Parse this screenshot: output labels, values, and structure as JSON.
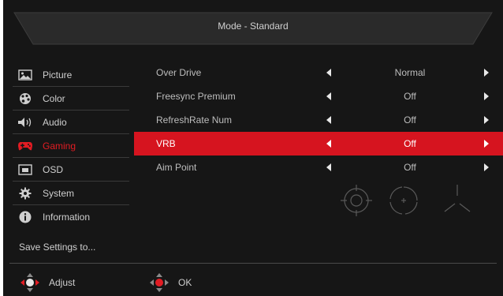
{
  "header": {
    "mode_title": "Mode - Standard"
  },
  "sidebar": {
    "items": [
      {
        "label": "Picture",
        "icon": "picture-icon"
      },
      {
        "label": "Color",
        "icon": "palette-icon"
      },
      {
        "label": "Audio",
        "icon": "speaker-icon"
      },
      {
        "label": "Gaming",
        "icon": "gamepad-icon",
        "active": true
      },
      {
        "label": "OSD",
        "icon": "osd-icon"
      },
      {
        "label": "System",
        "icon": "gear-icon"
      },
      {
        "label": "Information",
        "icon": "info-icon"
      }
    ],
    "save_label": "Save Settings to..."
  },
  "settings": [
    {
      "label": "Over Drive",
      "value": "Normal"
    },
    {
      "label": "Freesync Premium",
      "value": "Off"
    },
    {
      "label": "RefreshRate Num",
      "value": "Off"
    },
    {
      "label": "VRB",
      "value": "Off",
      "selected": true
    },
    {
      "label": "Aim Point",
      "value": "Off"
    }
  ],
  "aim_point_icons": [
    "aim-circle-icon",
    "aim-crosshair-icon",
    "aim-tripod-icon"
  ],
  "footer": {
    "adjust_label": "Adjust",
    "ok_label": "OK"
  },
  "colors": {
    "accent": "#d6141f",
    "background": "#161616",
    "text": "#cfcfcf"
  }
}
